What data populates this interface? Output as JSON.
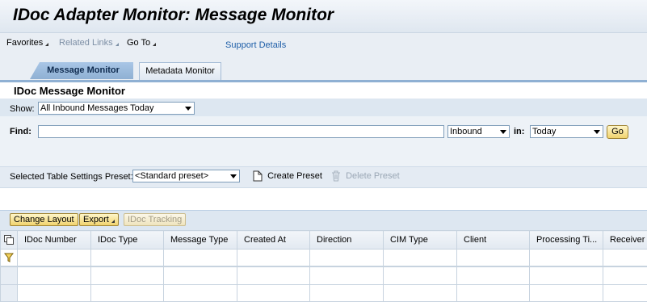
{
  "title": "IDoc Adapter Monitor: Message Monitor",
  "menu": {
    "favorites": "Favorites",
    "related_links": "Related Links",
    "go_to": "Go To",
    "support_details": "Support Details"
  },
  "tabs": [
    {
      "label": "Message Monitor",
      "active": true
    },
    {
      "label": "Metadata Monitor",
      "active": false
    }
  ],
  "section_title": "IDoc Message Monitor",
  "show": {
    "label": "Show:",
    "value": "All Inbound Messages Today"
  },
  "find": {
    "label": "Find:",
    "value": "",
    "direction": "Inbound",
    "in_label": "in:",
    "range": "Today",
    "go": "Go"
  },
  "preset": {
    "label": "Selected Table Settings Preset:",
    "value": "<Standard preset>",
    "create": "Create Preset",
    "delete": "Delete Preset"
  },
  "toolbar": {
    "change_layout": "Change Layout",
    "export": "Export",
    "idoc_tracking": "IDoc Tracking"
  },
  "table": {
    "columns": [
      "IDoc Number",
      "IDoc Type",
      "Message Type",
      "Created At",
      "Direction",
      "CIM Type",
      "Client",
      "Processing Ti...",
      "Receiver P"
    ]
  },
  "colors": {
    "accent": "#8fb0d3",
    "button": "#f1d36e",
    "link": "#1f5fa8"
  }
}
